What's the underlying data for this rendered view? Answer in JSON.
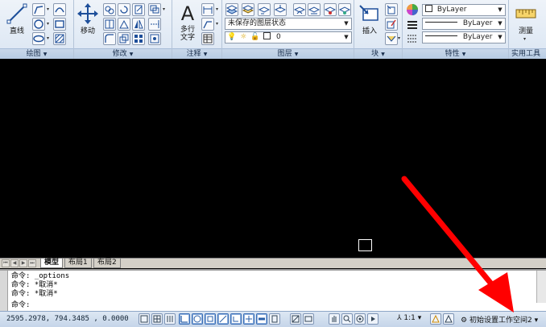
{
  "ribbon": {
    "draw": {
      "title": "绘图",
      "line_label": "直线"
    },
    "modify": {
      "title": "修改",
      "move_label": "移动"
    },
    "annotation": {
      "title": "注释",
      "mtext_label": "多行\n文字"
    },
    "layers": {
      "title": "图层",
      "layer_state": "未保存的图层状态",
      "current_layer": "0"
    },
    "block": {
      "title": "块",
      "insert_label": "插入"
    },
    "properties": {
      "title": "特性",
      "color": "ByLayer",
      "linetype": "ByLayer",
      "lineweight": "ByLayer"
    },
    "utilities": {
      "title": "实用工具",
      "measure_label": "测量"
    }
  },
  "layout_tabs": [
    "模型",
    "布局1",
    "布局2"
  ],
  "command_history": [
    "命令: _options",
    "命令: *取消*",
    "命令: *取消*",
    "命令:"
  ],
  "status": {
    "coordinates": "2595.2978,  794.3485 , 0.0000",
    "annotation_scale": "1:1",
    "workspace": "初始设置工作空间2"
  },
  "colors": {
    "canvas": "#000000",
    "annotation_arrow": "#ff0000",
    "ribbon_bg": "#dbe6f3"
  }
}
